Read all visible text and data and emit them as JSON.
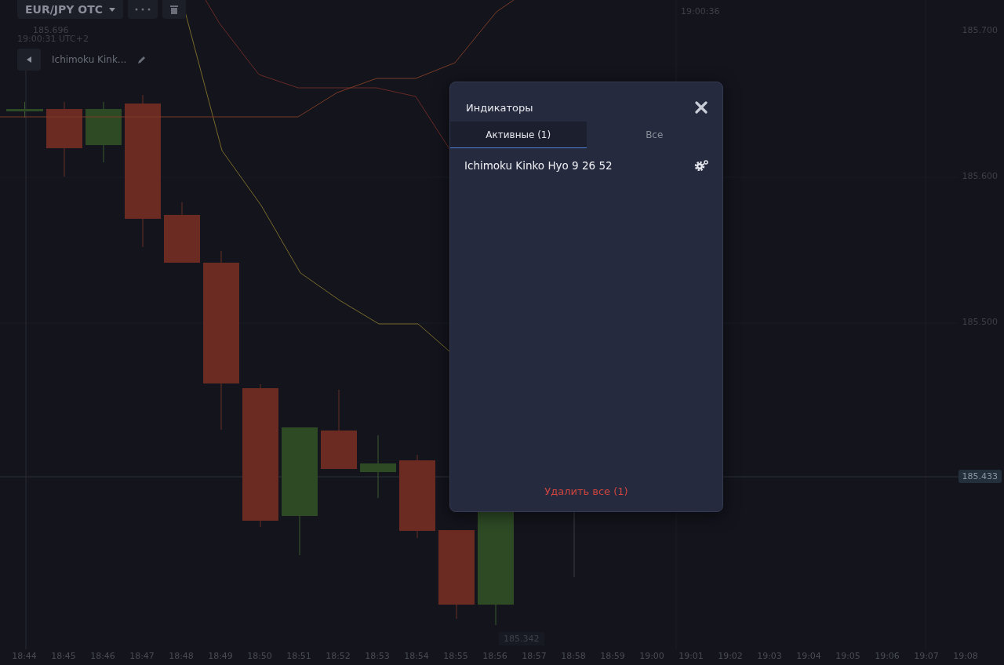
{
  "toolbar": {
    "pair": "EUR/JPY OTC"
  },
  "crosshair": {
    "price": "185.696",
    "time": "19:00:31 UTC+2"
  },
  "indicator_tag": {
    "label": "Ichimoku Kink..."
  },
  "expiry": {
    "time": "19:00:36"
  },
  "price_axis": [
    {
      "label": "185.700",
      "kind": "tick"
    },
    {
      "label": "185.600",
      "kind": "tick"
    },
    {
      "label": "185.500",
      "kind": "tick"
    },
    {
      "label": "185.433",
      "kind": "current"
    }
  ],
  "low_label": "185.342",
  "time_axis": [
    "18:44",
    "18:45",
    "18:46",
    "18:47",
    "18:48",
    "18:49",
    "18:50",
    "18:51",
    "18:52",
    "18:53",
    "18:54",
    "18:55",
    "18:56",
    "18:57",
    "18:58",
    "18:59",
    "19:00",
    "19:01",
    "19:02",
    "19:03",
    "19:04",
    "19:05",
    "19:06",
    "19:07",
    "19:08"
  ],
  "dialog": {
    "title": "Индикаторы",
    "tabs": [
      {
        "label": "Активные (1)",
        "selected": true
      },
      {
        "label": "Все",
        "selected": false
      }
    ],
    "items": [
      {
        "name": "Ichimoku Kinko Hyo 9 26 52"
      }
    ],
    "footer": "Удалить все (1)"
  }
}
